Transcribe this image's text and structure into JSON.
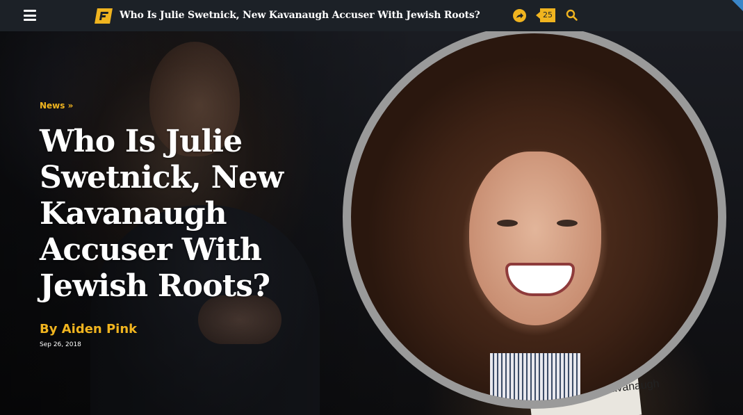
{
  "topbar": {
    "title": "Who Is Julie Swetnick, New Kavanaugh Accuser With Jewish Roots?",
    "comment_count": "25",
    "accent_color": "#f0b41f",
    "icons": [
      "menu-icon",
      "forward-logo",
      "share-icon",
      "comment-icon",
      "search-icon"
    ]
  },
  "article": {
    "category": "News »",
    "headline": "Who Is Julie Swetnick, New Kavanaugh Accuser With Jewish Roots?",
    "byline": "By Aiden Pink",
    "date": "Sep 26, 2018"
  },
  "hero_image": {
    "nameplate_text": "Hon. Brett M. Kavanaugh"
  }
}
